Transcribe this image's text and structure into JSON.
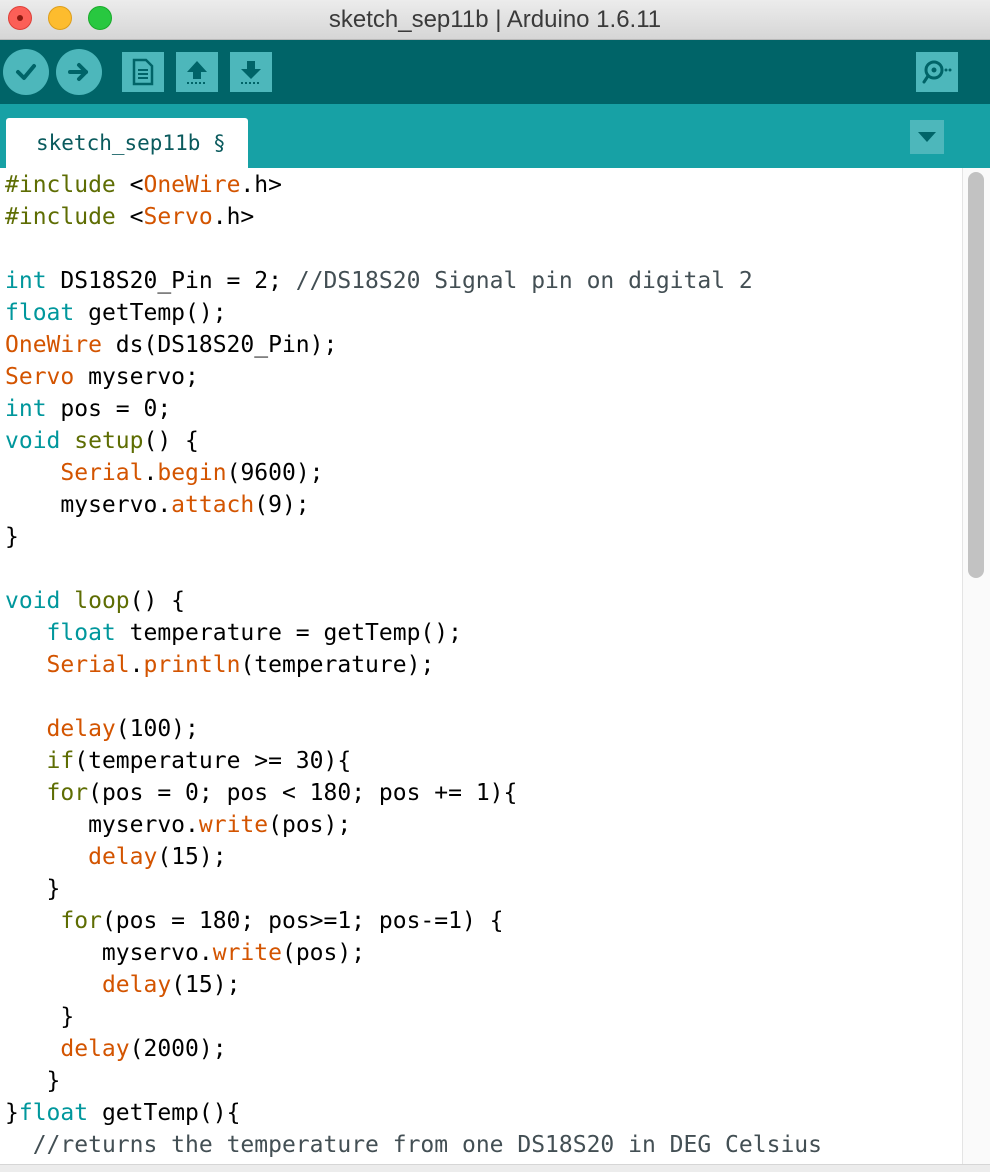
{
  "window": {
    "title": "sketch_sep11b | Arduino 1.6.11"
  },
  "toolbar": {
    "buttons": [
      {
        "name": "verify",
        "icon": "checkmark-icon"
      },
      {
        "name": "upload",
        "icon": "arrow-right-icon"
      },
      {
        "name": "new",
        "icon": "new-sketch-icon"
      },
      {
        "name": "open",
        "icon": "open-arrow-up-icon"
      },
      {
        "name": "save",
        "icon": "save-arrow-down-icon"
      },
      {
        "name": "serial-monitor",
        "icon": "magnifier-icon"
      }
    ]
  },
  "tabs": [
    {
      "label": "sketch_sep11b §",
      "active": true
    }
  ],
  "colors": {
    "toolbar_bg": "#006468",
    "tabbar_bg": "#17a1a5",
    "button_bg": "#4db7bb",
    "keyword": "#00979c",
    "library": "#d35400",
    "preprocessor": "#5e6d03",
    "comment": "#434f54"
  },
  "editor": {
    "lines": [
      [
        {
          "t": "pre",
          "v": "#include"
        },
        {
          "t": "plain",
          "v": " <"
        },
        {
          "t": "lib",
          "v": "OneWire"
        },
        {
          "t": "plain",
          "v": ".h>"
        }
      ],
      [
        {
          "t": "pre",
          "v": "#include"
        },
        {
          "t": "plain",
          "v": " <"
        },
        {
          "t": "lib",
          "v": "Servo"
        },
        {
          "t": "plain",
          "v": ".h>"
        }
      ],
      [],
      [
        {
          "t": "kw",
          "v": "int"
        },
        {
          "t": "plain",
          "v": " DS18S20_Pin = 2; "
        },
        {
          "t": "cmt",
          "v": "//DS18S20 Signal pin on digital 2"
        }
      ],
      [
        {
          "t": "kw",
          "v": "float"
        },
        {
          "t": "plain",
          "v": " getTemp();"
        }
      ],
      [
        {
          "t": "lib",
          "v": "OneWire"
        },
        {
          "t": "plain",
          "v": " ds(DS18S20_Pin);"
        }
      ],
      [
        {
          "t": "lib",
          "v": "Servo"
        },
        {
          "t": "plain",
          "v": " myservo;"
        }
      ],
      [
        {
          "t": "kw",
          "v": "int"
        },
        {
          "t": "plain",
          "v": " pos = 0;"
        }
      ],
      [
        {
          "t": "kw",
          "v": "void"
        },
        {
          "t": "plain",
          "v": " "
        },
        {
          "t": "pre",
          "v": "setup"
        },
        {
          "t": "plain",
          "v": "() {"
        }
      ],
      [
        {
          "t": "plain",
          "v": "    "
        },
        {
          "t": "lib",
          "v": "Serial"
        },
        {
          "t": "plain",
          "v": "."
        },
        {
          "t": "lib",
          "v": "begin"
        },
        {
          "t": "plain",
          "v": "(9600);"
        }
      ],
      [
        {
          "t": "plain",
          "v": "    myservo."
        },
        {
          "t": "lib",
          "v": "attach"
        },
        {
          "t": "plain",
          "v": "(9);"
        }
      ],
      [
        {
          "t": "plain",
          "v": "}"
        }
      ],
      [],
      [
        {
          "t": "kw",
          "v": "void"
        },
        {
          "t": "plain",
          "v": " "
        },
        {
          "t": "pre",
          "v": "loop"
        },
        {
          "t": "plain",
          "v": "() {"
        }
      ],
      [
        {
          "t": "plain",
          "v": "   "
        },
        {
          "t": "kw",
          "v": "float"
        },
        {
          "t": "plain",
          "v": " temperature = getTemp();"
        }
      ],
      [
        {
          "t": "plain",
          "v": "   "
        },
        {
          "t": "lib",
          "v": "Serial"
        },
        {
          "t": "plain",
          "v": "."
        },
        {
          "t": "lib",
          "v": "println"
        },
        {
          "t": "plain",
          "v": "(temperature);"
        }
      ],
      [],
      [
        {
          "t": "plain",
          "v": "   "
        },
        {
          "t": "lib",
          "v": "delay"
        },
        {
          "t": "plain",
          "v": "(100);"
        }
      ],
      [
        {
          "t": "plain",
          "v": "   "
        },
        {
          "t": "pre",
          "v": "if"
        },
        {
          "t": "plain",
          "v": "(temperature >= 30){"
        }
      ],
      [
        {
          "t": "plain",
          "v": "   "
        },
        {
          "t": "pre",
          "v": "for"
        },
        {
          "t": "plain",
          "v": "(pos = 0; pos < 180; pos += 1){"
        }
      ],
      [
        {
          "t": "plain",
          "v": "      myservo."
        },
        {
          "t": "lib",
          "v": "write"
        },
        {
          "t": "plain",
          "v": "(pos);"
        }
      ],
      [
        {
          "t": "plain",
          "v": "      "
        },
        {
          "t": "lib",
          "v": "delay"
        },
        {
          "t": "plain",
          "v": "(15);"
        }
      ],
      [
        {
          "t": "plain",
          "v": "   }"
        }
      ],
      [
        {
          "t": "plain",
          "v": "    "
        },
        {
          "t": "pre",
          "v": "for"
        },
        {
          "t": "plain",
          "v": "(pos = 180; pos>=1; pos-=1) {"
        }
      ],
      [
        {
          "t": "plain",
          "v": "       myservo."
        },
        {
          "t": "lib",
          "v": "write"
        },
        {
          "t": "plain",
          "v": "(pos);"
        }
      ],
      [
        {
          "t": "plain",
          "v": "       "
        },
        {
          "t": "lib",
          "v": "delay"
        },
        {
          "t": "plain",
          "v": "(15);"
        }
      ],
      [
        {
          "t": "plain",
          "v": "    }"
        }
      ],
      [
        {
          "t": "plain",
          "v": "    "
        },
        {
          "t": "lib",
          "v": "delay"
        },
        {
          "t": "plain",
          "v": "(2000);"
        }
      ],
      [
        {
          "t": "plain",
          "v": "   }"
        }
      ],
      [
        {
          "t": "plain",
          "v": "}"
        },
        {
          "t": "kw",
          "v": "float"
        },
        {
          "t": "plain",
          "v": " getTemp(){"
        }
      ],
      [
        {
          "t": "plain",
          "v": "  "
        },
        {
          "t": "cmt",
          "v": "//returns the temperature from one DS18S20 in DEG Celsius"
        }
      ]
    ]
  }
}
